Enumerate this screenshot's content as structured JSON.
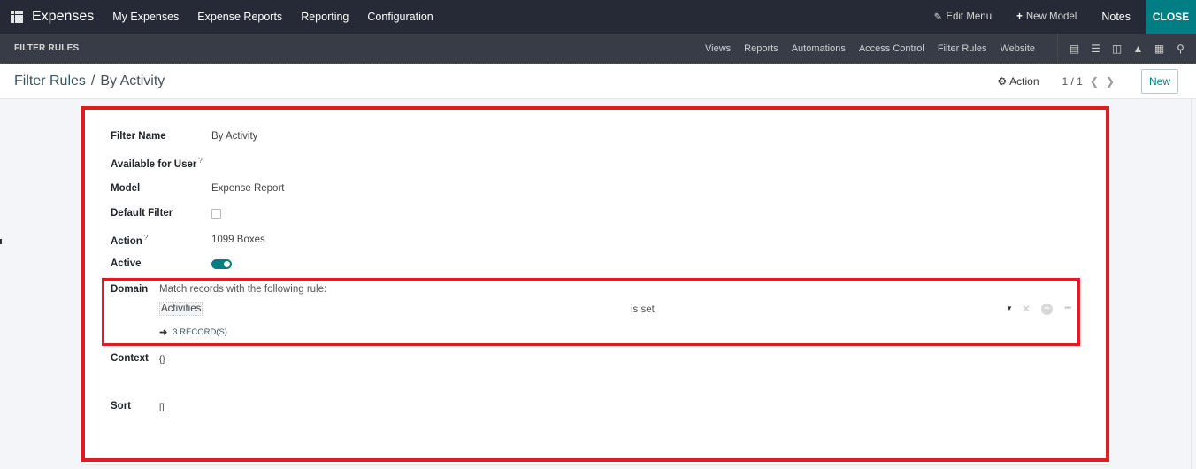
{
  "topbar": {
    "app_name": "Expenses",
    "menu": [
      "My Expenses",
      "Expense Reports",
      "Reporting",
      "Configuration"
    ],
    "edit_menu": "Edit Menu",
    "new_model": "New Model",
    "notes": "Notes",
    "close": "CLOSE"
  },
  "subbar": {
    "title": "FILTER RULES",
    "menu": [
      "Views",
      "Reports",
      "Automations",
      "Access Control",
      "Filter Rules",
      "Website"
    ],
    "view_icons": [
      "form-view-icon",
      "list-view-icon",
      "kanban-view-icon",
      "graph-view-icon",
      "pivot-view-icon",
      "search-view-icon"
    ]
  },
  "control_panel": {
    "breadcrumb_parent": "Filter Rules",
    "breadcrumb_sep": "/",
    "breadcrumb_current": "By Activity",
    "action_label": "Action",
    "pager": "1 / 1",
    "new_label": "New"
  },
  "form": {
    "filter_name_label": "Filter Name",
    "filter_name_value": "By Activity",
    "available_for_user_label": "Available for User",
    "available_for_user_help": "?",
    "model_label": "Model",
    "model_value": "Expense Report",
    "default_filter_label": "Default Filter",
    "default_filter_checked": false,
    "action_label": "Action",
    "action_help": "?",
    "action_value": "1099 Boxes",
    "active_label": "Active",
    "active_on": true,
    "domain_label": "Domain",
    "domain_description": "Match records with the following rule:",
    "domain_field": "Activities",
    "domain_operator": "is set",
    "records_count": "3 RECORD(S)",
    "context_label": "Context",
    "context_value": "{}",
    "sort_label": "Sort",
    "sort_value": "[]"
  },
  "colors": {
    "brand": "#017e84",
    "navbar": "#262a36",
    "subbar": "#383c47",
    "highlight": "#e21a23"
  }
}
